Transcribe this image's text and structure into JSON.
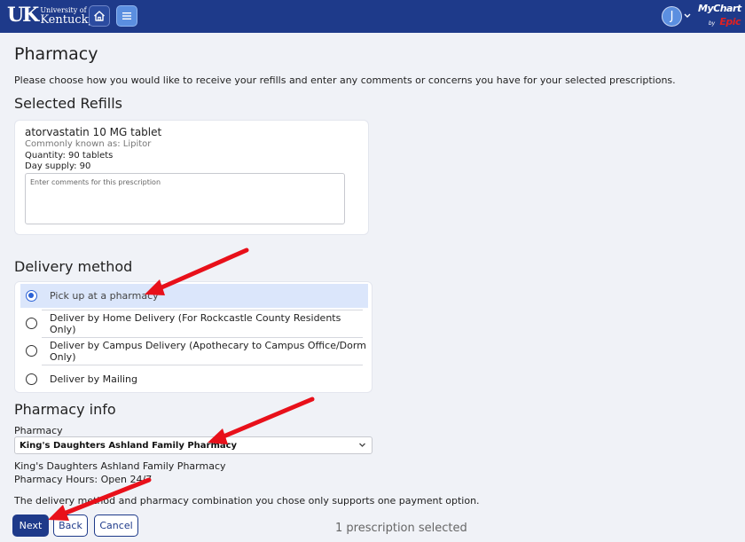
{
  "header": {
    "logo_line1": "University of",
    "logo_line2": "Kentucky.",
    "logo_mark": "UK",
    "home_icon": "home-icon",
    "menu_icon": "menu-icon",
    "avatar_initial": "J",
    "brand_mychart": "MyChart",
    "brand_by": "by",
    "brand_epic": "Epic",
    "bar_color": "#1e3a8a"
  },
  "page": {
    "title": "Pharmacy",
    "intro": "Please choose how you would like to receive your refills and enter any comments or concerns you have for your selected prescriptions."
  },
  "refills": {
    "heading": "Selected Refills",
    "item": {
      "name": "atorvastatin 10 MG tablet",
      "alias": "Commonly known as: Lipitor",
      "quantity": "Quantity: 90 tablets",
      "day_supply": "Day supply: 90",
      "comment_value": "",
      "comment_placeholder": "Enter comments for this prescription"
    }
  },
  "delivery": {
    "heading": "Delivery method",
    "options": [
      {
        "label": "Pick up at a pharmacy",
        "selected": true
      },
      {
        "label": "Deliver by Home Delivery (For Rockcastle County Residents Only)",
        "selected": false
      },
      {
        "label": "Deliver by Campus Delivery (Apothecary to Campus Office/Dorm Only)",
        "selected": false
      },
      {
        "label": "Deliver by Mailing",
        "selected": false
      }
    ]
  },
  "pharmacy": {
    "heading": "Pharmacy info",
    "field_label": "Pharmacy",
    "selected": "King's Daughters Ashland Family Pharmacy",
    "name": "King's Daughters Ashland Family Pharmacy",
    "hours": "Pharmacy Hours: Open 24/7"
  },
  "payment_note": "The delivery method and pharmacy combination you chose only supports one payment option.",
  "actions": {
    "next": "Next",
    "back": "Back",
    "cancel": "Cancel",
    "selected_count": "1 prescription selected"
  },
  "colors": {
    "primary": "#1e3a8a",
    "selected_row": "#dbe6fb",
    "radio_active": "#2b62d6",
    "annotation_arrow": "#e8101a"
  }
}
